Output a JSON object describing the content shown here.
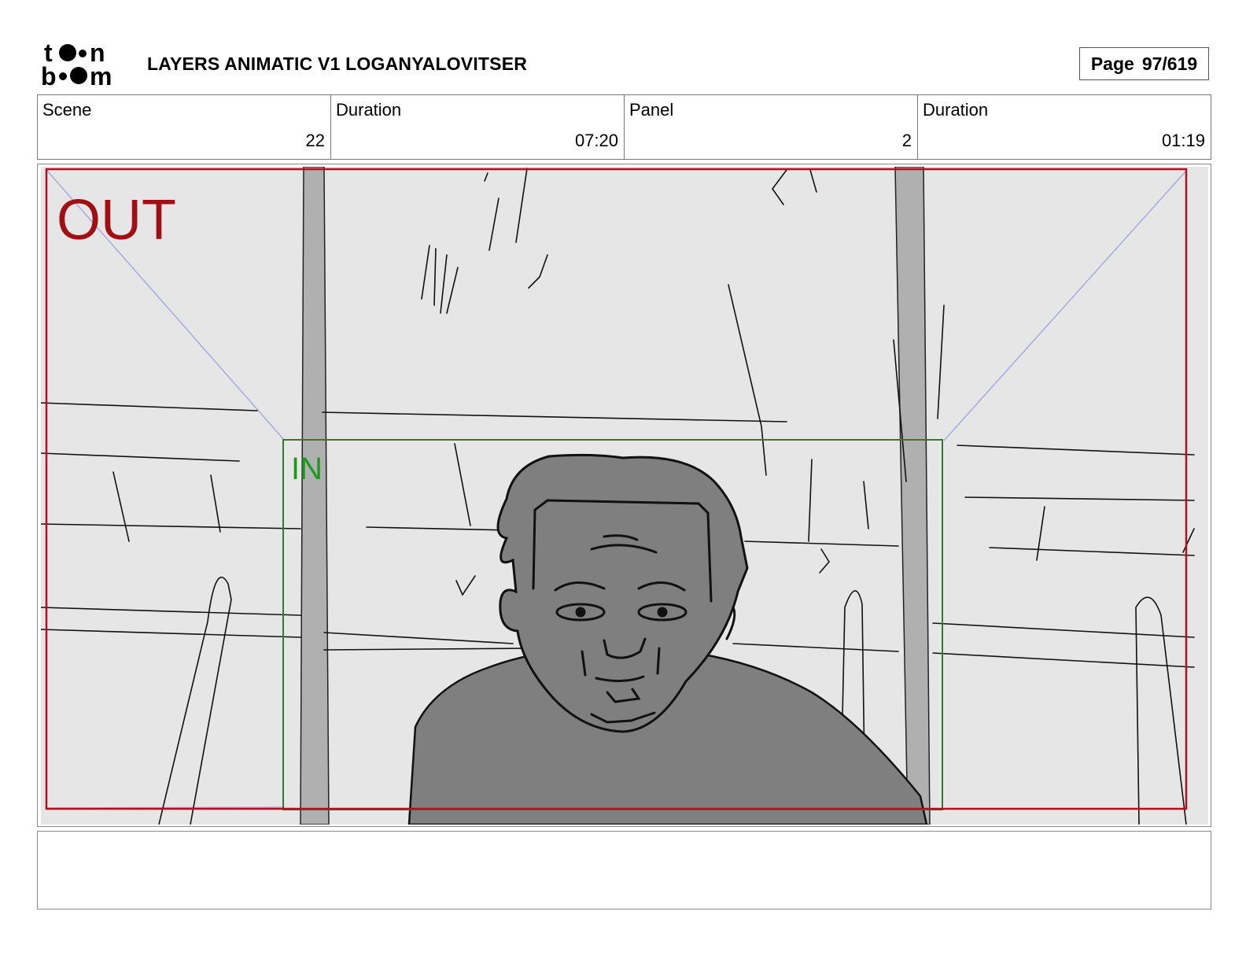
{
  "header": {
    "logo": {
      "line1": "toon",
      "line2": "boom",
      "icon": "toon-boom-logo"
    },
    "title": "LAYERS ANIMATIC V1 LOGANYALOVITSER",
    "page_label": "Page",
    "page_value": "97/619"
  },
  "info": [
    {
      "label": "Scene",
      "value": "22"
    },
    {
      "label": "Duration",
      "value": "07:20"
    },
    {
      "label": "Panel",
      "value": "2"
    },
    {
      "label": "Duration",
      "value": "01:19"
    }
  ],
  "panel": {
    "out_label": "OUT",
    "in_label": "IN",
    "colors": {
      "out_frame": "#b01020",
      "in_frame": "#2e7d32",
      "background": "#e6e6e6",
      "figure": "#7f7f7f",
      "pillar": "#b0b0b0"
    }
  },
  "notes": {
    "text": ""
  }
}
